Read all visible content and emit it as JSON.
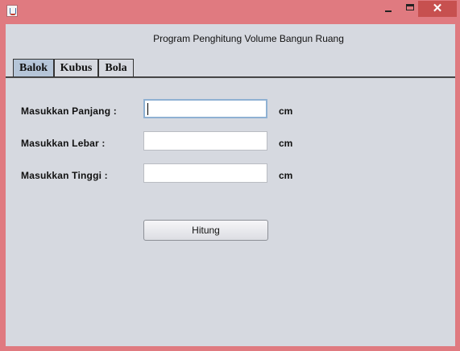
{
  "window": {
    "heading": "Program Penghitung Volume Bangun Ruang",
    "close_glyph": "✕"
  },
  "tabs": [
    {
      "label": "Balok",
      "active": true
    },
    {
      "label": "Kubus",
      "active": false
    },
    {
      "label": "Bola",
      "active": false
    }
  ],
  "form": {
    "panjang": {
      "label": "Masukkan Panjang  :",
      "value": "",
      "unit": "cm"
    },
    "lebar": {
      "label": "Masukkan Lebar     :",
      "value": "",
      "unit": "cm"
    },
    "tinggi": {
      "label": "Masukkan Tinggi     :",
      "value": "",
      "unit": "cm"
    },
    "button_label": "Hitung"
  },
  "colors": {
    "frame": "#e07a80",
    "content_bg": "#d6d9e0",
    "active_tab": "#b5c5d8",
    "close_button": "#c7504f"
  },
  "icons": [
    "java-app-icon",
    "minimize-icon",
    "maximize-icon",
    "close-icon"
  ]
}
